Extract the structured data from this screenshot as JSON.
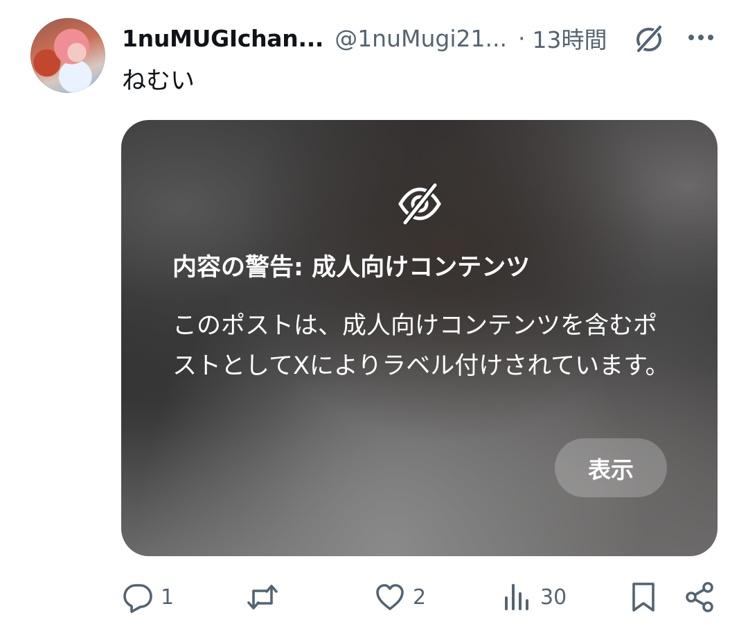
{
  "post": {
    "display_name": "1nuMUGIchan...",
    "handle": "@1nuMugi21...",
    "separator": "·",
    "time": "13時間",
    "text": "ねむい"
  },
  "media_warning": {
    "title": "内容の警告: 成人向けコンテンツ",
    "body": "このポストは、成人向けコンテンツを含むポストとしてXによりラベル付けされています。",
    "show_button": "表示"
  },
  "actions": {
    "reply_count": "1",
    "repost_count": "",
    "like_count": "2",
    "views_count": "30"
  },
  "colors": {
    "text_primary": "#0f1419",
    "text_secondary": "#536471",
    "background": "#ffffff"
  },
  "icons": [
    "grok-icon",
    "more-icon",
    "eye-slash-icon",
    "reply-icon",
    "repost-icon",
    "like-icon",
    "views-icon",
    "bookmark-icon",
    "share-icon"
  ]
}
